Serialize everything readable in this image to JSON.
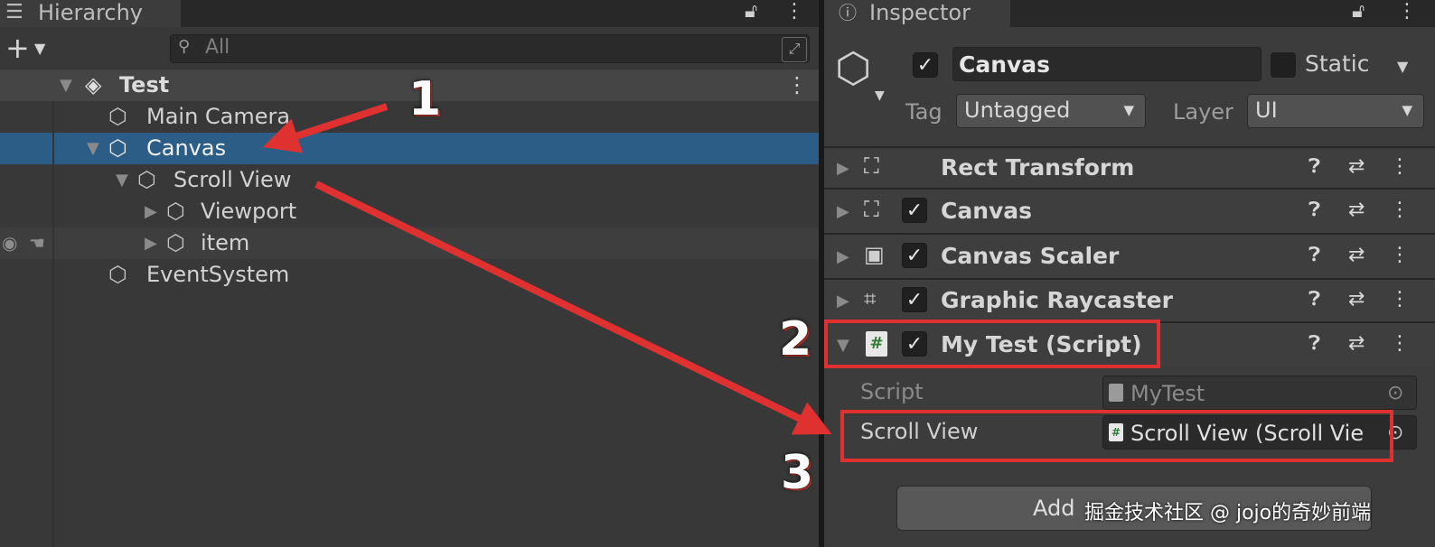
{
  "hierarchy": {
    "tab_label": "Hierarchy",
    "search_placeholder": "All",
    "scene_name": "Test",
    "items": [
      {
        "label": "Main Camera"
      },
      {
        "label": "Canvas"
      },
      {
        "label": "Scroll View"
      },
      {
        "label": "Viewport"
      },
      {
        "label": "item"
      },
      {
        "label": "EventSystem"
      }
    ]
  },
  "inspector": {
    "tab_label": "Inspector",
    "object_name": "Canvas",
    "static_label": "Static",
    "tag_label": "Tag",
    "tag_value": "Untagged",
    "layer_label": "Layer",
    "layer_value": "UI",
    "components": [
      {
        "title": "Rect Transform",
        "icon": "rect-transform-icon"
      },
      {
        "title": "Canvas",
        "icon": "canvas-icon"
      },
      {
        "title": "Canvas Scaler",
        "icon": "canvas-scaler-icon"
      },
      {
        "title": "Graphic Raycaster",
        "icon": "graphic-raycaster-icon"
      },
      {
        "title": "My Test (Script)",
        "icon": "script-icon"
      }
    ],
    "fields": [
      {
        "label": "Script",
        "value": "MyTest"
      },
      {
        "label": "Scroll View",
        "value": "Scroll View (Scroll Vie"
      }
    ],
    "add_component_label": "Add"
  },
  "annotations": {
    "num1": "1",
    "num2": "2",
    "num3": "3",
    "accent_color": "#e03131"
  },
  "watermark": "掘金技术社区 @ jojo的奇妙前端",
  "colors": {
    "selection": "#2c5d87",
    "panel": "#383838"
  }
}
